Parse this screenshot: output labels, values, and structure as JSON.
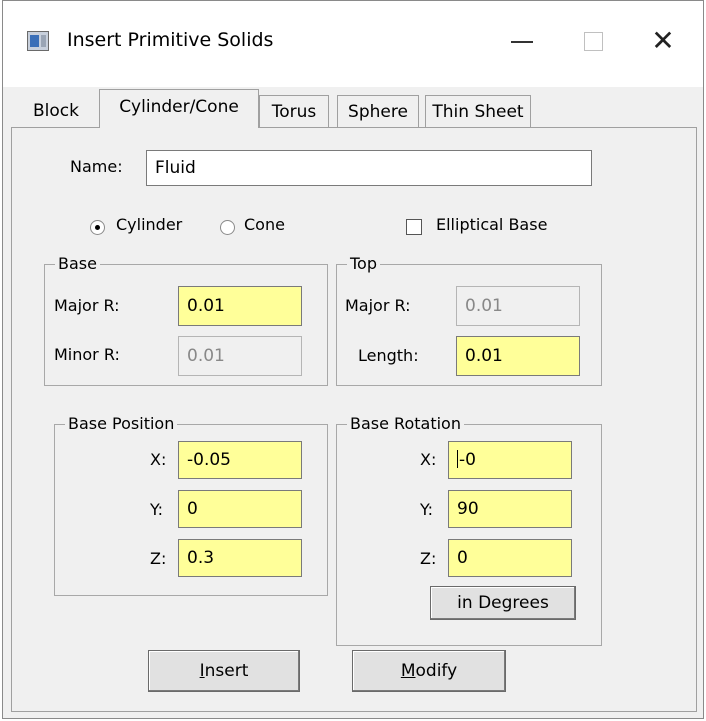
{
  "window": {
    "title": "Insert Primitive Solids",
    "controls": {
      "minimize": "—",
      "maximize": "☐",
      "close": "✕"
    }
  },
  "tabs": [
    "Block",
    "Cylinder/Cone",
    "Torus",
    "Sphere",
    "Thin Sheet"
  ],
  "active_tab": "Cylinder/Cone",
  "name": {
    "label": "Name:",
    "value": "Fluid"
  },
  "shape": {
    "cylinder_label": "Cylinder",
    "cone_label": "Cone",
    "selected": "Cylinder",
    "elliptical_label": "Elliptical Base",
    "elliptical_checked": false
  },
  "base": {
    "legend": "Base",
    "major_r_label": "Major R:",
    "major_r": "0.01",
    "minor_r_label": "Minor R:",
    "minor_r": "0.01"
  },
  "top": {
    "legend": "Top",
    "major_r_label": "Major R:",
    "major_r": "0.01",
    "length_label": "Length:",
    "length": "0.01"
  },
  "base_position": {
    "legend": "Base Position",
    "x_label": "X:",
    "x": "-0.05",
    "y_label": "Y:",
    "y": "0",
    "z_label": "Z:",
    "z": "0.3"
  },
  "base_rotation": {
    "legend": "Base Rotation",
    "x_label": "X:",
    "x": "-0",
    "y_label": "Y:",
    "y": "90",
    "z_label": "Z:",
    "z": "0",
    "units_button": "in Degrees"
  },
  "buttons": {
    "insert_mnemonic": "I",
    "insert_rest": "nsert",
    "modify_mnemonic": "M",
    "modify_rest": "odify"
  },
  "colors": {
    "input_highlight": "#ffff99",
    "panel_bg": "#f0f0f0"
  }
}
